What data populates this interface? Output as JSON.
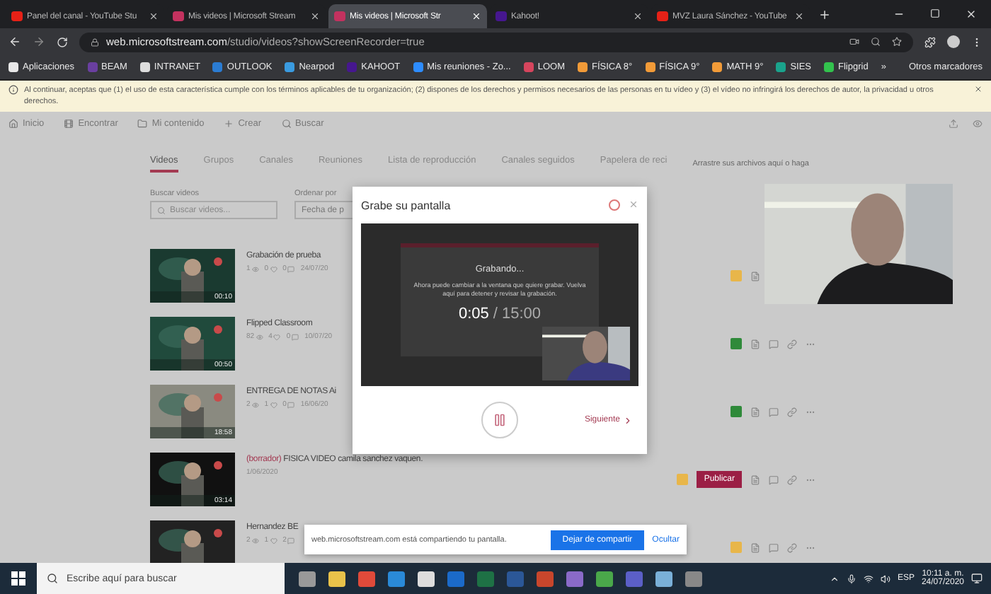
{
  "browser": {
    "tabs": [
      {
        "title": "Panel del canal - YouTube Stu",
        "kind": "youtube",
        "selected": false
      },
      {
        "title": "Mis videos | Microsoft Stream",
        "kind": "stream",
        "selected": false
      },
      {
        "title": "Mis videos | Microsoft Str",
        "kind": "stream",
        "selected": true
      },
      {
        "title": "Kahoot!",
        "kind": "kahoot",
        "selected": false
      },
      {
        "title": "MVZ Laura Sánchez - YouTube",
        "kind": "youtube",
        "selected": false
      }
    ],
    "address": {
      "host": "web.microsoftstream.com",
      "path": "/studio/videos?showScreenRecorder=true"
    },
    "bookmarks": [
      {
        "label": "Aplicaciones",
        "color": "#e8e8e8"
      },
      {
        "label": "BEAM",
        "color": "#6a3fa0"
      },
      {
        "label": "INTRANET",
        "color": "#dddddd"
      },
      {
        "label": "OUTLOOK",
        "color": "#2b7cd3"
      },
      {
        "label": "Nearpod",
        "color": "#3a9be0"
      },
      {
        "label": "KAHOOT",
        "color": "#46178f"
      },
      {
        "label": "Mis reuniones - Zo...",
        "color": "#2d8cff"
      },
      {
        "label": "LOOM",
        "color": "#d6455d"
      },
      {
        "label": "FÍSICA 8°",
        "color": "#f29b38"
      },
      {
        "label": "FÍSICA 9°",
        "color": "#f29b38"
      },
      {
        "label": "MATH 9°",
        "color": "#f29b38"
      },
      {
        "label": "SIES",
        "color": "#1aa38c"
      },
      {
        "label": "Flipgrid",
        "color": "#32c24d"
      }
    ],
    "overflow": "»",
    "other": "Otros marcadores"
  },
  "notice": "Al continuar, aceptas que (1) el uso de esta característica cumple con los términos aplicables de tu organización; (2) dispones de los derechos y permisos necesarios de las personas en tu vídeo y (3) el vídeo no infringirá los derechos de autor, la privacidad u otros derechos.",
  "nav": [
    {
      "label": "Inicio",
      "kind": "home"
    },
    {
      "label": "Encontrar",
      "kind": "find"
    },
    {
      "label": "Mi contenido",
      "kind": "content"
    },
    {
      "label": "Crear",
      "kind": "create"
    },
    {
      "label": "Buscar",
      "kind": "search"
    }
  ],
  "stream_tabs": [
    {
      "label": "Videos",
      "selected": true
    },
    {
      "label": "Grupos",
      "selected": false
    },
    {
      "label": "Canales",
      "selected": false
    },
    {
      "label": "Reuniones",
      "selected": false
    },
    {
      "label": "Lista de reproducción",
      "selected": false
    },
    {
      "label": "Canales seguidos",
      "selected": false
    },
    {
      "label": "Papelera de reci",
      "selected": false
    }
  ],
  "upload_hint": "Arrastre sus archivos aquí o haga",
  "search": {
    "label": "Buscar videos",
    "placeholder": "Buscar videos..."
  },
  "sort": {
    "label": "Ordenar por",
    "value": "Fecha de p"
  },
  "videos": [
    {
      "title": "Grabación de prueba",
      "stats": [
        "1",
        "0",
        "0"
      ],
      "date": "24/07/20",
      "duration": "00:10",
      "color": "#e8b64a",
      "actions": [
        {
          "kind": "details"
        }
      ]
    },
    {
      "title": "Flipped Classroom",
      "stats": [
        "82",
        "4",
        "0"
      ],
      "date": "10/07/20",
      "duration": "00:50",
      "color": "#2f8a3a",
      "actions": [
        {
          "kind": "details"
        },
        {
          "kind": "comment"
        },
        {
          "kind": "link"
        },
        {
          "kind": "more"
        }
      ]
    },
    {
      "title": "ENTREGA DE NOTAS Ai",
      "stats": [
        "2",
        "1",
        "0"
      ],
      "date": "16/06/20",
      "duration": "18:58",
      "color": "#2f8a3a",
      "actions": [
        {
          "kind": "details"
        },
        {
          "kind": "comment"
        },
        {
          "kind": "link"
        },
        {
          "kind": "more"
        }
      ]
    },
    {
      "title": "FISICA VIDEO camila sanchez vaquen.",
      "draft_label": "(borrador)",
      "date": "1/06/2020",
      "duration": "03:14",
      "color": "#e8b64a",
      "publish_label": "Publicar",
      "actions": [
        {
          "kind": "details"
        },
        {
          "kind": "comment"
        },
        {
          "kind": "link"
        },
        {
          "kind": "more"
        }
      ]
    },
    {
      "title": "Hernandez BE",
      "stats": [
        "2",
        "1",
        "2"
      ],
      "color": "#e8b64a",
      "actions": [
        {
          "kind": "details"
        },
        {
          "kind": "comment"
        },
        {
          "kind": "link"
        },
        {
          "kind": "more"
        }
      ]
    }
  ],
  "recorder": {
    "title": "Grabe su pantalla",
    "status": "Grabando...",
    "message": "Ahora puede cambiar a la ventana que quiere grabar. Vuelva aquí para detener y revisar la grabación.",
    "elapsed": "0:05",
    "limit": "/ 15:00",
    "next": "Siguiente"
  },
  "share_bar": {
    "message": "web.microsoftstream.com está compartiendo tu pantalla.",
    "stop": "Dejar de compartir",
    "hide": "Ocultar"
  },
  "taskbar": {
    "search_placeholder": "Escribe aquí para buscar",
    "language": "ESP",
    "time": "10:11 a. m.",
    "date": "24/07/2020"
  }
}
